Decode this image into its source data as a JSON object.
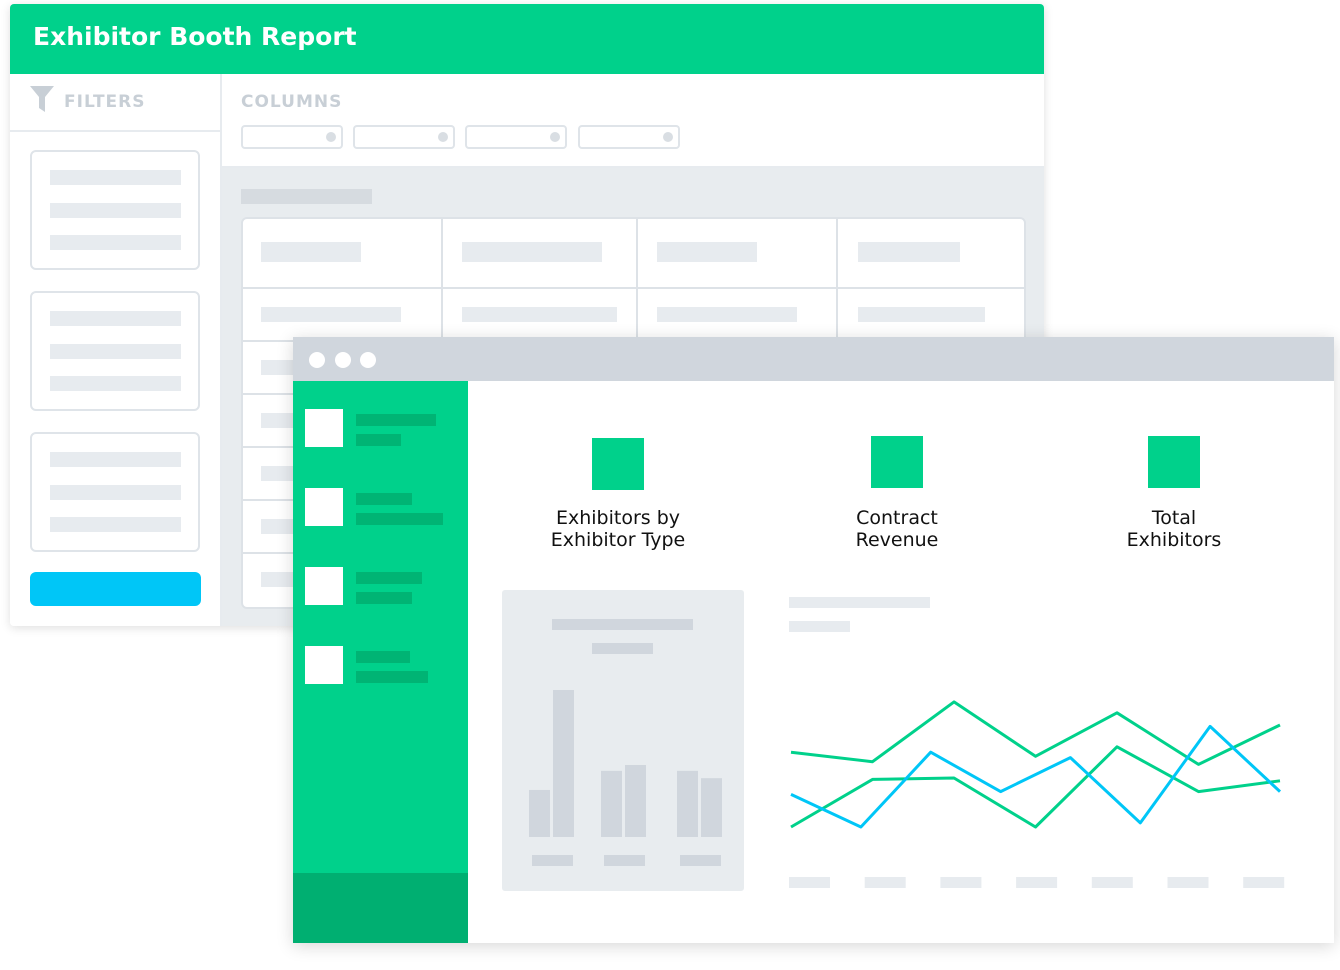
{
  "report": {
    "title": "Exhibitor Booth Report",
    "filters_label": "FILTERS",
    "columns_label": "COLUMNS"
  },
  "dashboard": {
    "kpis": [
      {
        "label_line1": "Exhibitors by",
        "label_line2": "Exhibitor Type"
      },
      {
        "label_line1": "Contract",
        "label_line2": "Revenue"
      },
      {
        "label_line1": "Total",
        "label_line2": "Exhibitors"
      }
    ]
  },
  "colors": {
    "brand_green": "#00d18b",
    "dark_green": "#00af71",
    "accent_blue": "#00c6f7",
    "placeholder_gray": "#e7ebef"
  },
  "icons": [
    "funnel-icon",
    "window-dot-icon"
  ],
  "chart_data": [
    {
      "type": "bar",
      "categories": [
        "",
        "",
        ""
      ],
      "series": [
        {
          "values": [
            0.32,
            0.45,
            0.45
          ]
        },
        {
          "values": [
            1.0,
            0.49,
            0.4
          ]
        }
      ],
      "ylim": [
        0,
        1
      ],
      "grid": false
    },
    {
      "type": "line",
      "x": [
        0,
        1,
        2,
        3,
        4,
        5,
        6,
        7,
        8,
        9,
        10,
        11
      ],
      "series": [
        {
          "color": "#00d18b",
          "values": [
            0.55,
            0.48,
            0.92,
            0.52,
            0.84,
            0.46,
            0.75
          ]
        },
        {
          "color": "#00d18b",
          "values": [
            0.0,
            0.35,
            0.36,
            0.0,
            0.59,
            0.26,
            0.34
          ]
        },
        {
          "color": "#00c6f7",
          "values": [
            0.24,
            0.0,
            0.55,
            0.26,
            0.51,
            0.03,
            0.74,
            0.26
          ]
        }
      ],
      "ylim": [
        0,
        1
      ],
      "grid": false
    }
  ]
}
